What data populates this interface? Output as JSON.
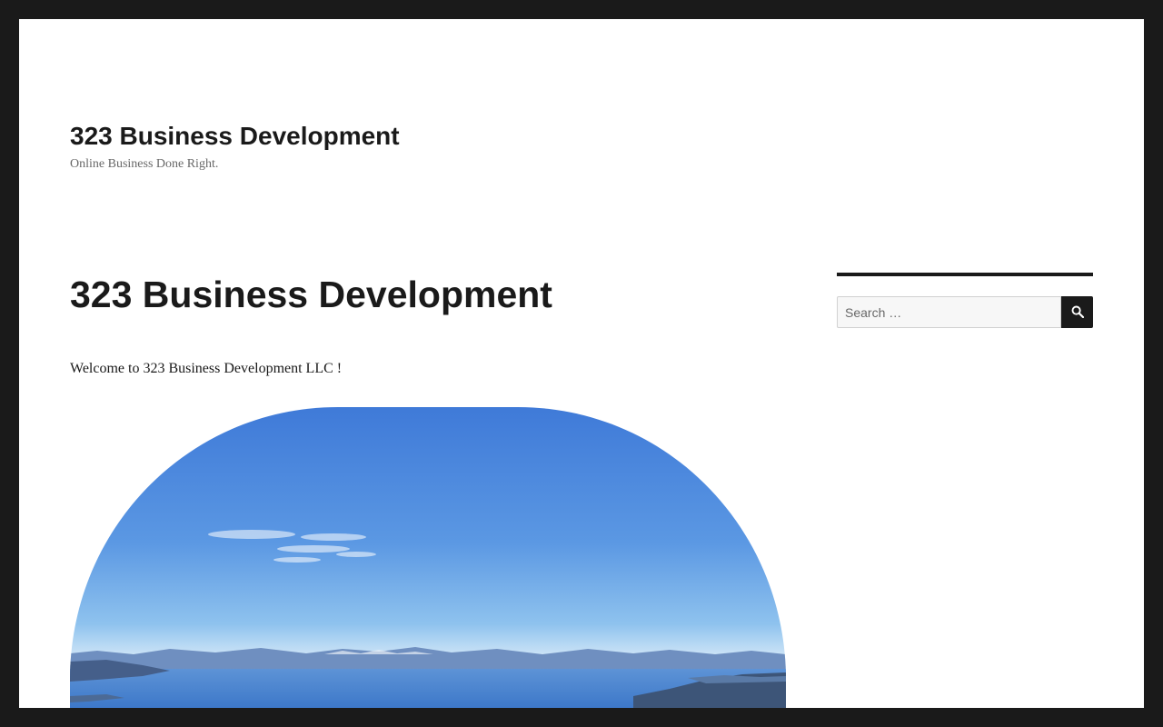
{
  "site": {
    "title": "323 Business Development",
    "tagline": "Online Business Done Right."
  },
  "entry": {
    "title": "323 Business Development",
    "welcome_text": "Welcome to 323 Business Development LLC !"
  },
  "sidebar": {
    "search": {
      "placeholder": "Search …",
      "value": "",
      "submit_label": "Search",
      "submit_icon": "search-icon"
    }
  },
  "colors": {
    "frame": "#1a1a1a",
    "page_background": "#ffffff",
    "text": "#1a1a1a",
    "tagline": "#686868",
    "search_button": "#1a1a1a"
  }
}
